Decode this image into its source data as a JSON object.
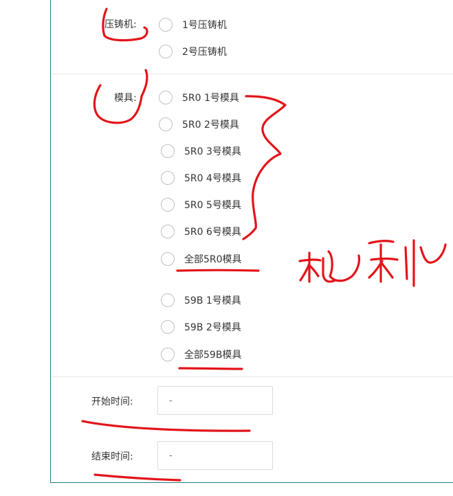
{
  "machine": {
    "label": "压铸机:",
    "options": [
      "1号压铸机",
      "2号压铸机"
    ]
  },
  "mold": {
    "label": "模具:",
    "options": [
      "5R0 1号模具",
      "5R0 2号模具",
      "5R0 3号模具",
      "5R0 4号模具",
      "5R0 5号模具",
      "5R0 6号模具",
      "全部5R0模具",
      "59B 1号模具",
      "59B 2号模具",
      "全部59B模具"
    ]
  },
  "start_time": {
    "label": "开始时间:",
    "placeholder": "-"
  },
  "end_time": {
    "label": "结束时间:",
    "placeholder": "-"
  },
  "annotation": {
    "handwritten_text": "机种"
  },
  "colors": {
    "ink": "#e2141a",
    "frame": "#1f7f7a",
    "radio_border": "#bfbfbf"
  }
}
